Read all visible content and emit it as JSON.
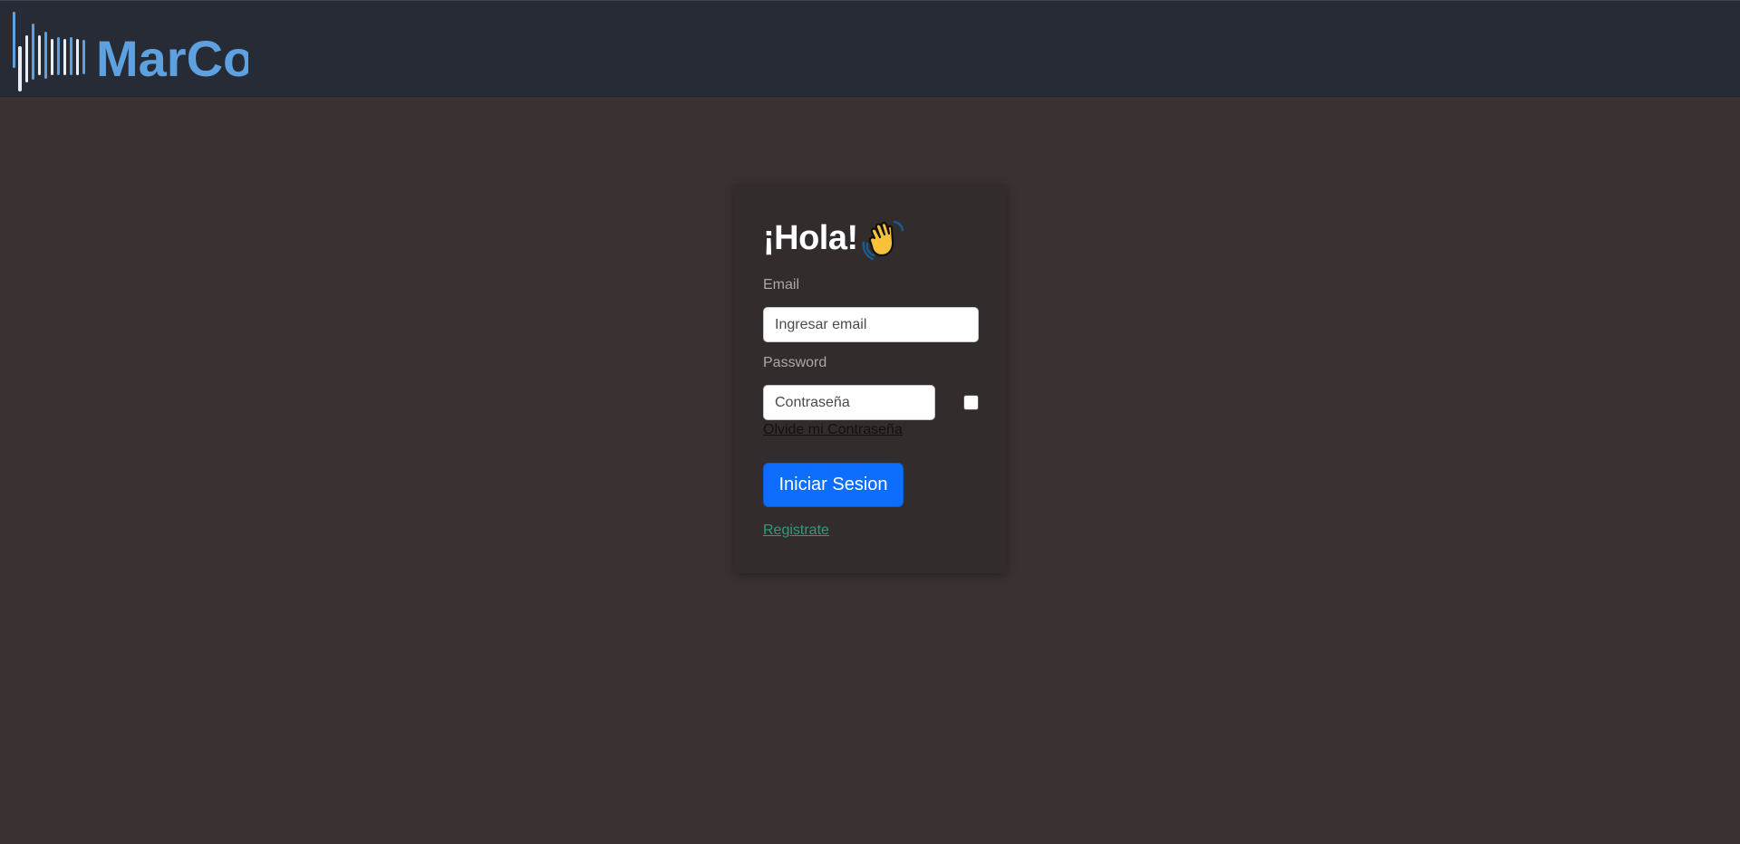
{
  "header": {
    "logo_text": "MarCo",
    "colors": {
      "background": "#262b35",
      "logo_blue": "#5ea1e0",
      "logo_white": "#e9eef5"
    }
  },
  "login": {
    "greeting": "¡Hola!",
    "greeting_emoji_icon": "waving-hand-icon",
    "email_label": "Email",
    "email_placeholder": "Ingresar email",
    "email_value": "",
    "password_label": "Password",
    "password_placeholder": "Contraseña",
    "password_value": "",
    "show_password_checked": false,
    "forgot_password_link": "Olvide mi Contraseña",
    "submit_button": "Iniciar Sesion",
    "register_link": "Registrate",
    "colors": {
      "page_background": "#3a3232",
      "card_background": "#332c2c",
      "button": "#0d6efd",
      "register_link": "#2e9e7a"
    }
  }
}
